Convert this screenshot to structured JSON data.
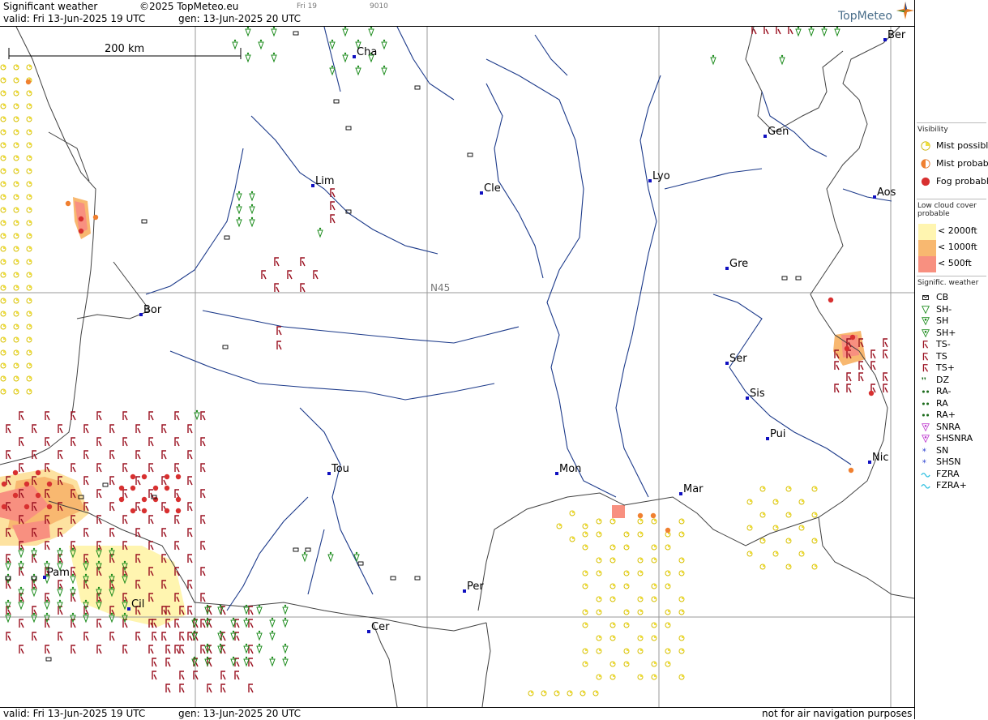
{
  "header": {
    "product": "Significant weather",
    "copyright": "©2025 TopMeteo.eu",
    "valid": "valid:  Fri  13-Jun-2025  19 UTC",
    "gen": "gen: 13-Jun-2025  20 UTC",
    "day_tab": "Fri 19",
    "code": "9010",
    "logo": "TopMeteo"
  },
  "footer": {
    "valid": "valid:  Fri  13-Jun-2025  19 UTC",
    "gen": "gen: 13-Jun-2025  20 UTC",
    "disclaimer": "not for air navigation purposes"
  },
  "map": {
    "scale_label": "200 km",
    "latitude_label": "N45",
    "cities": [
      "Cha",
      "Lim",
      "Cle",
      "Lyo",
      "Gen",
      "Ber",
      "Aos",
      "Gre",
      "Bor",
      "Ser",
      "Sis",
      "Pui",
      "Nic",
      "Mar",
      "Tou",
      "Mon",
      "Pam",
      "Cil",
      "Cer",
      "Per"
    ],
    "colors": {
      "rivers": "#1c3a8a",
      "borders": "#404040",
      "grid": "#999999",
      "city_marker": "#1010c0",
      "thunder": "#9a1020",
      "showers": "#1a8a1a",
      "mist": "#f0e040"
    }
  },
  "legend": {
    "visibility": {
      "title": "Visibility",
      "items": [
        "Mist possible",
        "Mist probable",
        "Fog probable"
      ]
    },
    "low_cloud": {
      "title": "Low cloud cover probable",
      "items": [
        "< 2000ft",
        "< 1000ft",
        "<   500ft"
      ]
    },
    "sigwx": {
      "title": "Signific. weather",
      "items": [
        "CB",
        "SH-",
        "SH",
        "SH+",
        "TS-",
        "TS",
        "TS+",
        "DZ",
        "RA-",
        "RA",
        "RA+",
        "SNRA",
        "SHSNRA",
        "SN",
        "SHSN",
        "FZRA",
        "FZRA+"
      ]
    }
  }
}
